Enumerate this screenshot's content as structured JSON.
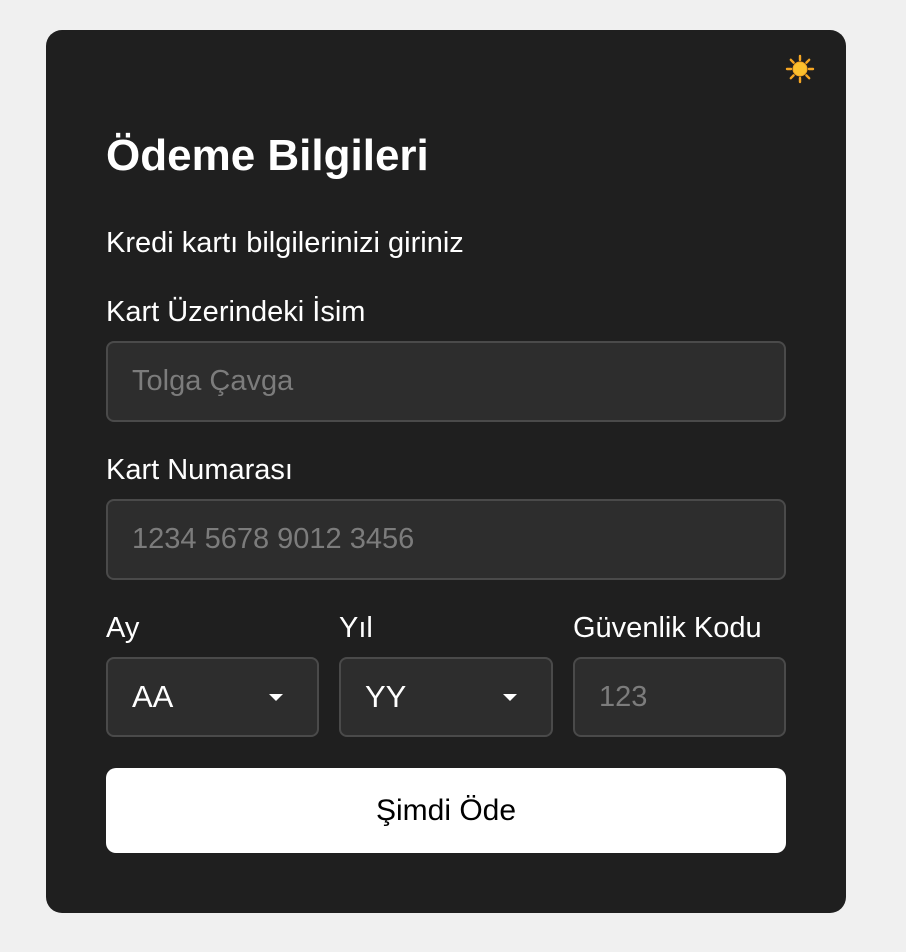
{
  "theme_toggle": {
    "icon": "sun-icon"
  },
  "header": {
    "title": "Ödeme Bilgileri",
    "subtitle": "Kredi kartı bilgilerinizi giriniz"
  },
  "form": {
    "name": {
      "label": "Kart Üzerindeki İsim",
      "value": "",
      "placeholder": "Tolga Çavga"
    },
    "card_number": {
      "label": "Kart Numarası",
      "value": "",
      "placeholder": "1234 5678 9012 3456"
    },
    "month": {
      "label": "Ay",
      "selected": "AA"
    },
    "year": {
      "label": "Yıl",
      "selected": "YY"
    },
    "cvc": {
      "label": "Güvenlik Kodu",
      "value": "",
      "placeholder": "123"
    },
    "submit_label": "Şimdi Öde"
  },
  "colors": {
    "page_background": "#f0f0f0",
    "card_background": "#1f1f1f",
    "field_background": "#2d2d2d",
    "field_border": "#4a4a4a",
    "button_background": "#ffffff",
    "sun": "#f5a623"
  }
}
